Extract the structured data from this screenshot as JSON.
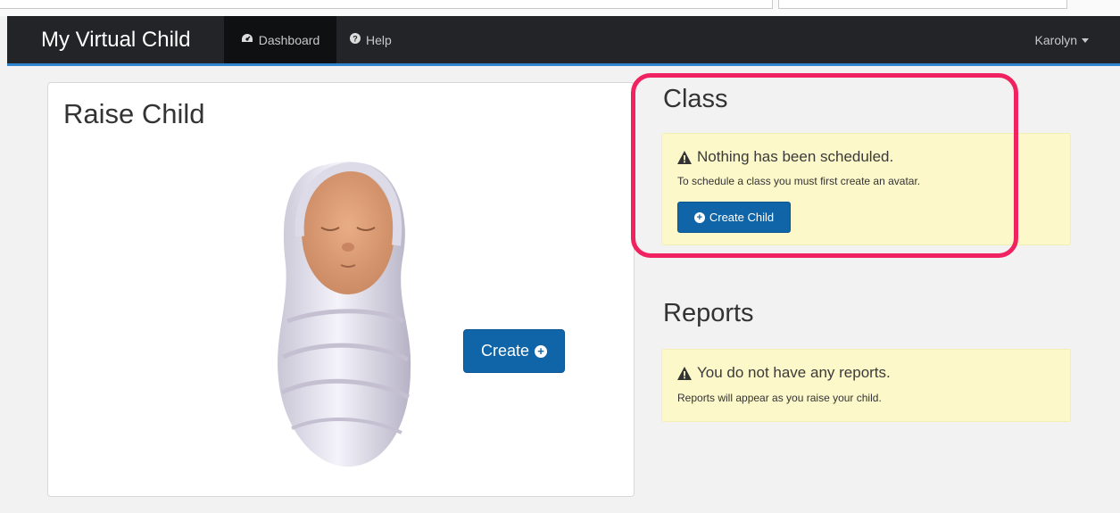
{
  "navbar": {
    "brand": "My Virtual Child",
    "items": [
      {
        "label": "Dashboard",
        "icon": "dashboard-icon"
      },
      {
        "label": "Help",
        "icon": "question-circle-icon"
      }
    ],
    "user": "Karolyn"
  },
  "raise_child": {
    "title": "Raise Child",
    "create_label": "Create"
  },
  "class_section": {
    "title": "Class",
    "alert_heading": "Nothing has been scheduled.",
    "alert_text": "To schedule a class you must first create an avatar.",
    "button_label": "Create Child"
  },
  "reports_section": {
    "title": "Reports",
    "alert_heading": "You do not have any reports.",
    "alert_text": "Reports will appear as you raise your child."
  },
  "colors": {
    "navbar_bg": "#222427",
    "accent_line": "#2f86cf",
    "button_primary": "#0f65a8",
    "alert_bg": "#fcf8c9",
    "highlight": "#f0225f"
  }
}
